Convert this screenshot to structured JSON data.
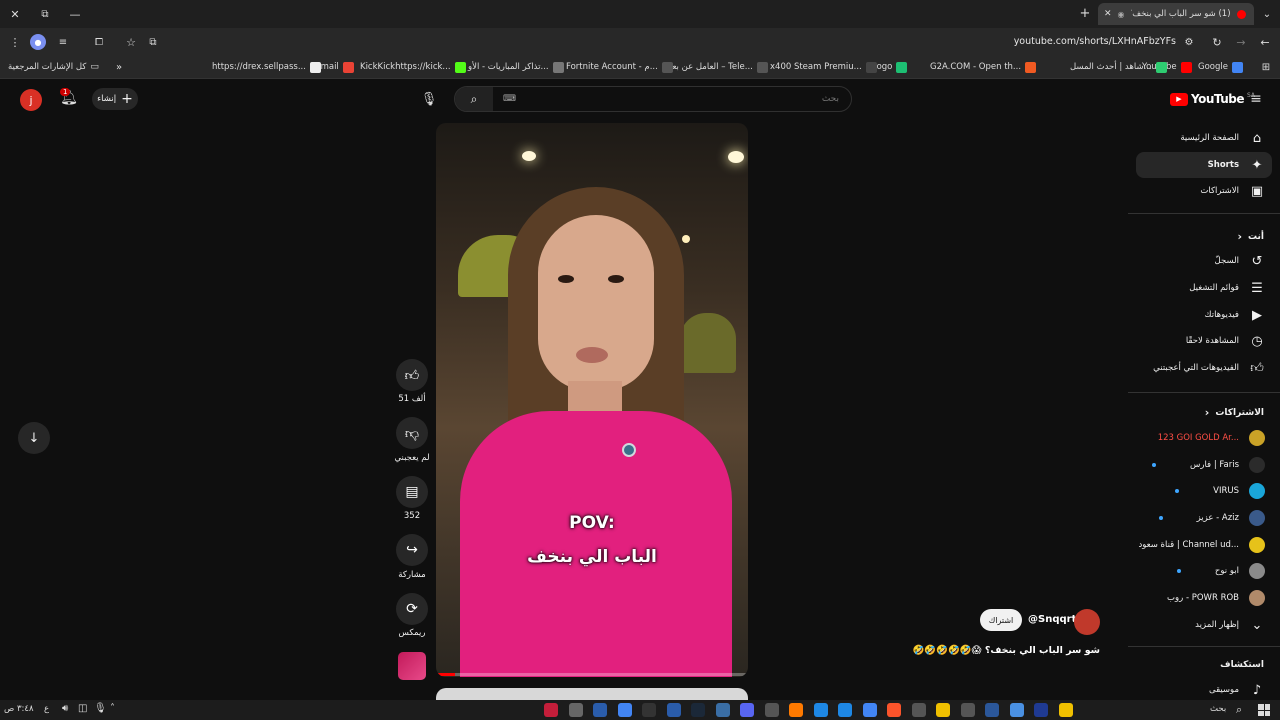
{
  "browser": {
    "tab_title": "(1) شو سر الباب الي بنخف؟ 🤣😱",
    "tab_badge": "",
    "url": "youtube.com/shorts/LXHnAFbzYFs",
    "all_bookmarks": "كل الإشارات المرجعية",
    "bookmarks": [
      {
        "label": "YouTube",
        "color": "#ff0000"
      },
      {
        "label": "Google",
        "color": "#4285f4"
      },
      {
        "label": "شاهد | أحدث المسل...",
        "color": "#2ecc71"
      },
      {
        "label": "G2A.COM - Open th...",
        "color": "#f05a22"
      },
      {
        "label": "Logo",
        "color": "#1dbf73"
      },
      {
        "label": "x400 Steam Premiu...",
        "color": "#444"
      },
      {
        "label": "العامل عن بعد – Tele...",
        "color": "#555"
      },
      {
        "label": "Fortnite Account - م...",
        "color": "#555"
      },
      {
        "label": "تذاكر المباريات - الأو...",
        "color": "#777"
      },
      {
        "label": "KickKickhttps://kick...",
        "color": "#53fc18"
      },
      {
        "label": "Gmail",
        "color": "#ea4335"
      },
      {
        "label": "https://drex.sellpass...",
        "color": "#eee"
      }
    ]
  },
  "header": {
    "logo": "YouTube",
    "region": "SA",
    "search_placeholder": "بحث",
    "create_label": "إنشاء",
    "notif_count": "1",
    "avatar_letter": "j"
  },
  "sidebar": {
    "main": [
      {
        "label": "الصفحة الرئيسية",
        "icon": "home-icon"
      },
      {
        "label": "Shorts",
        "icon": "shorts-icon",
        "active": true
      },
      {
        "label": "الاشتراكات",
        "icon": "subscriptions-icon"
      }
    ],
    "you_title": "أنت",
    "you_items": [
      {
        "label": "السجلّ",
        "icon": "history-icon"
      },
      {
        "label": "قوائم التشغيل",
        "icon": "playlists-icon"
      },
      {
        "label": "فيديوهاتك",
        "icon": "your-videos-icon"
      },
      {
        "label": "المشاهدة لاحقًا",
        "icon": "watch-later-icon"
      },
      {
        "label": "الفيديوهات التي أعجبتني",
        "icon": "liked-icon"
      }
    ],
    "subs_title": "الاشتراكات",
    "subs": [
      {
        "label": "123 GOI GOLD Ar...",
        "color": "#c9a227",
        "live": true
      },
      {
        "label": "فارس | Faris",
        "color": "#2b2b2b",
        "dot": true
      },
      {
        "label": "VIRUS",
        "color": "#1aa6d9",
        "dot": true
      },
      {
        "label": "عزيز - Aziz",
        "color": "#3a5a8a",
        "dot": true
      },
      {
        "label": "قناة سعود | Channel ud...",
        "color": "#e6c21a",
        "dot": false
      },
      {
        "label": "ابو نوح",
        "color": "#8a8a8a",
        "dot": true
      },
      {
        "label": "روب - POWR ROB",
        "color": "#b08a6a",
        "dot": false
      }
    ],
    "show_more": "إظهار المزيد",
    "explore_title": "استكشاف",
    "explore_items": [
      {
        "label": "موسيقى",
        "icon": "music-icon"
      }
    ]
  },
  "short": {
    "caption_line1": "POV:",
    "caption_line2": "الباب الي بنخف",
    "channel_handle": "@Snqqrt",
    "subscribe_label": "اشتراك",
    "title": "شو سر الباب الي بنخف؟ 😱🤣🤣🤣🤣🤣",
    "likes": "51 ألف",
    "dislike_label": "لم يعجبني",
    "comments": "352",
    "share_label": "مشاركة",
    "remix_label": "ريمكس"
  },
  "taskbar": {
    "time": "٣:٤٨ ص",
    "lang": "ع",
    "search": "بحث"
  }
}
